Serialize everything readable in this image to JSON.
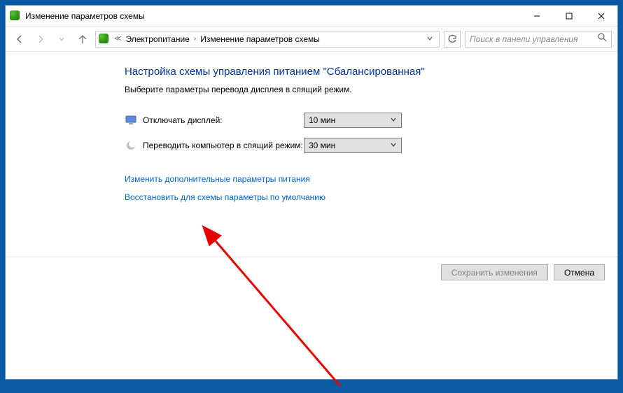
{
  "titlebar": {
    "title": "Изменение параметров схемы"
  },
  "nav": {
    "breadcrumb1": "Электропитание",
    "breadcrumb2": "Изменение параметров схемы"
  },
  "search": {
    "placeholder": "Поиск в панели управления"
  },
  "main": {
    "heading": "Настройка схемы управления питанием \"Сбалансированная\"",
    "subheading": "Выберите параметры перевода дисплея в спящий режим.",
    "settings": {
      "display_off_label": "Отключать дисплей:",
      "display_off_value": "10 мин",
      "sleep_label": "Переводить компьютер в спящий режим:",
      "sleep_value": "30 мин"
    },
    "links": {
      "advanced": "Изменить дополнительные параметры питания",
      "restore": "Восстановить для схемы параметры по умолчанию"
    },
    "buttons": {
      "save": "Сохранить изменения",
      "cancel": "Отмена"
    }
  }
}
